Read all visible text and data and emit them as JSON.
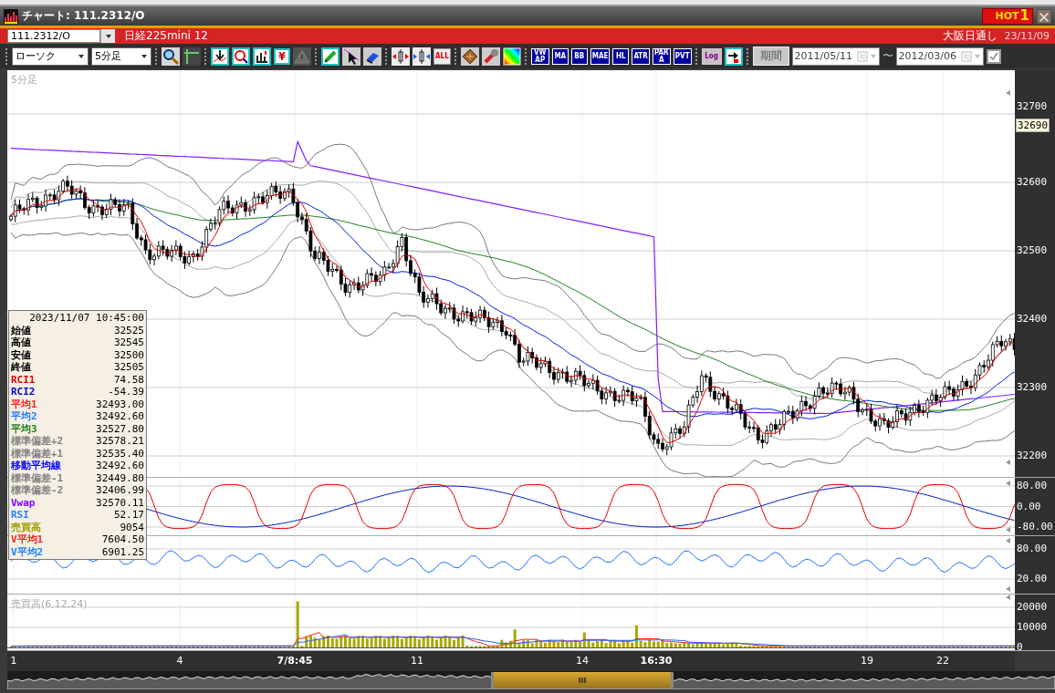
{
  "window": {
    "title": "チャート: 111.2312/O",
    "hot_badge": {
      "label": "HOT",
      "number": "1"
    }
  },
  "symbol_bar": {
    "symbol": "111.2312/O",
    "name": "日経225mini 12",
    "session": "大阪日通し",
    "date": "23/11/09"
  },
  "toolbar": {
    "groups": [
      {
        "items": [
          {
            "kind": "select",
            "value": "ローソク"
          },
          {
            "kind": "select",
            "value": "5分足"
          }
        ]
      },
      {
        "items": [
          {
            "kind": "icon",
            "disabled": false
          },
          {
            "kind": "icon",
            "disabled": false
          }
        ]
      },
      {
        "items": [
          {
            "kind": "icon",
            "disabled": false
          },
          {
            "kind": "icon",
            "disabled": false
          },
          {
            "kind": "icon",
            "disabled": false
          },
          {
            "kind": "label-red",
            "label": "¥",
            "disabled": false
          },
          {
            "kind": "icon",
            "disabled": true
          }
        ]
      },
      {
        "items": [
          {
            "kind": "icon",
            "disabled": false
          },
          {
            "kind": "icon",
            "disabled": false
          },
          {
            "kind": "icon",
            "disabled": false
          }
        ]
      },
      {
        "items": [
          {
            "kind": "icon",
            "disabled": false
          },
          {
            "kind": "icon",
            "disabled": false
          },
          {
            "kind": "label-red",
            "label": "ALL",
            "disabled": false
          }
        ]
      },
      {
        "items": [
          {
            "kind": "icon",
            "disabled": false
          },
          {
            "kind": "icon",
            "disabled": false
          },
          {
            "kind": "icon",
            "disabled": false
          }
        ]
      },
      {
        "items": [
          {
            "kind": "label-stacked",
            "label": "VWAP",
            "disabled": false
          },
          {
            "kind": "label",
            "label": "MA",
            "disabled": false
          },
          {
            "kind": "label",
            "label": "BB",
            "disabled": false
          },
          {
            "kind": "label",
            "label": "MAE",
            "disabled": false
          },
          {
            "kind": "label",
            "label": "HL",
            "disabled": false
          },
          {
            "kind": "label",
            "label": "ATR",
            "disabled": false
          },
          {
            "kind": "label-stacked",
            "label": "PARA",
            "disabled": false
          },
          {
            "kind": "label",
            "label": "PVT",
            "disabled": false
          }
        ]
      },
      {
        "items": [
          {
            "kind": "label-gray",
            "label": "Log",
            "disabled": false
          },
          {
            "kind": "icon",
            "disabled": false
          }
        ]
      },
      {
        "items": [
          {
            "kind": "button",
            "label": "期間"
          },
          {
            "kind": "date",
            "value": "2011/05/11"
          },
          {
            "kind": "text",
            "label": "〜"
          },
          {
            "kind": "date",
            "value": "2012/03/06"
          },
          {
            "kind": "checkbox",
            "checked": true
          }
        ]
      }
    ]
  },
  "chart": {
    "interval_label": "5分足",
    "price_axis": [
      "32700",
      "32600",
      "32500",
      "32400",
      "32300",
      "32200"
    ],
    "last_price": "32690",
    "rci_axis": [
      "80.00",
      "0.00",
      "-80.00"
    ],
    "rsi_axis": [
      "80.00",
      "20.00"
    ],
    "volume_label": "売買高(6,12,24)",
    "volume_axis": [
      "20000",
      "10000",
      "0"
    ],
    "time_axis": [
      {
        "label": "1",
        "bold": false
      },
      {
        "label": "4",
        "bold": false
      },
      {
        "label": "7/8:45",
        "bold": true
      },
      {
        "label": "11",
        "bold": false
      },
      {
        "label": "14",
        "bold": false
      },
      {
        "label": "16:30",
        "bold": true
      },
      {
        "label": "19",
        "bold": false
      },
      {
        "label": "22",
        "bold": false
      }
    ],
    "data_window": {
      "timestamp": "2023/11/07  10:45:00",
      "rows": [
        {
          "label": "始値",
          "value": "32525",
          "color": "#000000"
        },
        {
          "label": "高値",
          "value": "32545",
          "color": "#000000"
        },
        {
          "label": "安値",
          "value": "32500",
          "color": "#000000"
        },
        {
          "label": "終値",
          "value": "32505",
          "color": "#000000"
        },
        {
          "label": "RCI1",
          "value": "74.58",
          "color": "#e00000"
        },
        {
          "label": "RCI2",
          "value": "-54.39",
          "color": "#0000c0"
        },
        {
          "label": "平均1",
          "value": "32493.00",
          "color": "#ff2020"
        },
        {
          "label": "平均2",
          "value": "32492.60",
          "color": "#2080ff"
        },
        {
          "label": "平均3",
          "value": "32527.80",
          "color": "#208020"
        },
        {
          "label": "標準偏差+2",
          "value": "32578.21",
          "color": "#808080"
        },
        {
          "label": "標準偏差+1",
          "value": "32535.40",
          "color": "#808080"
        },
        {
          "label": "移動平均線",
          "value": "32492.60",
          "color": "#0000ff"
        },
        {
          "label": "標準偏差-1",
          "value": "32449.80",
          "color": "#808080"
        },
        {
          "label": "標準偏差-2",
          "value": "32406.99",
          "color": "#808080"
        },
        {
          "label": "Vwap",
          "value": "32570.11",
          "color": "#8000ff"
        },
        {
          "label": "RSI",
          "value": "52.17",
          "color": "#2080ff"
        },
        {
          "label": "売買高",
          "value": "9054",
          "color": "#a0a000"
        },
        {
          "label": "V平均1",
          "value": "7604.50",
          "color": "#ff2020"
        },
        {
          "label": "V平均2",
          "value": "6901.25",
          "color": "#2080ff"
        }
      ]
    }
  }
}
